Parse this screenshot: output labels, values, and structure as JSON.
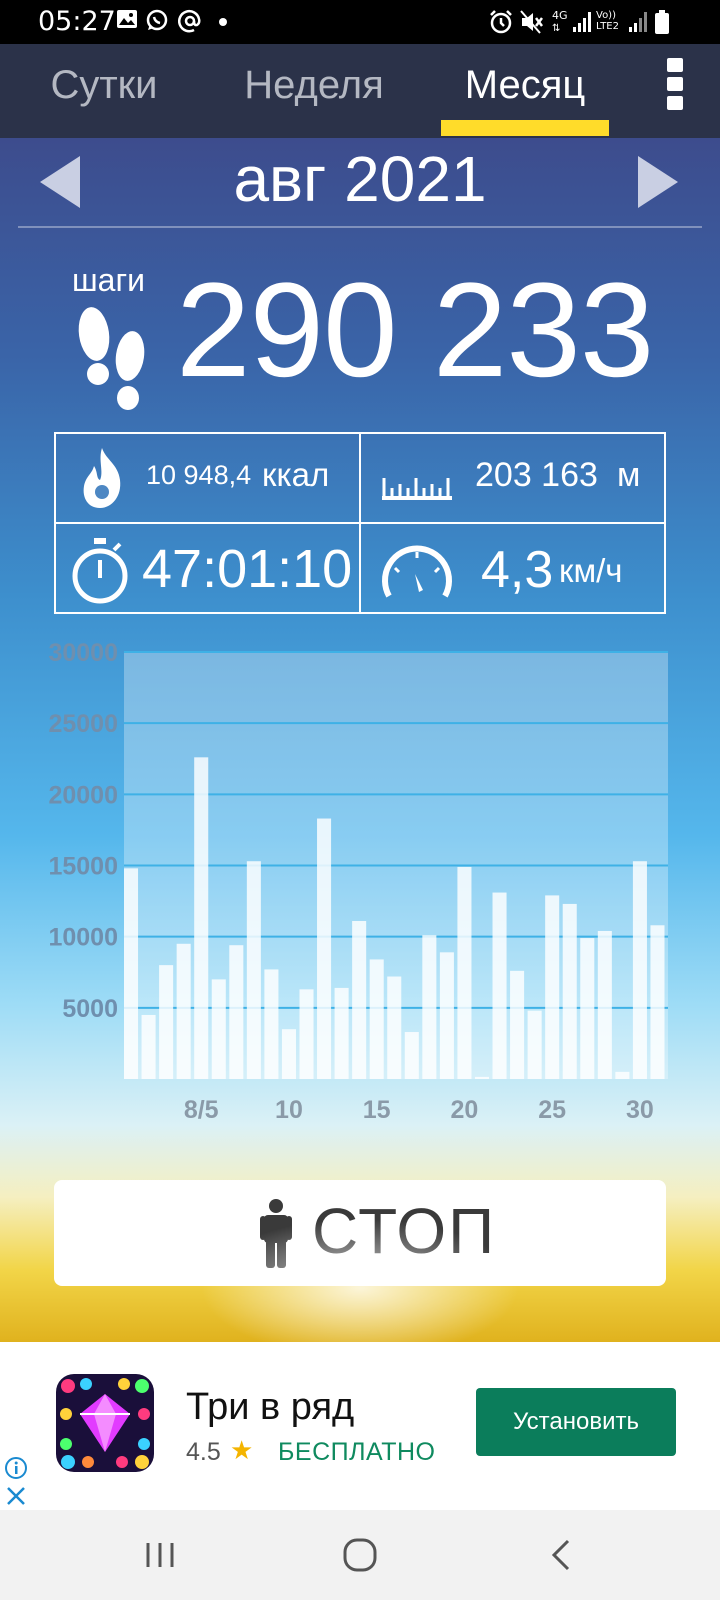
{
  "status_bar": {
    "time": "05:27",
    "left_icons": [
      "image-icon",
      "whatsapp-icon",
      "at-icon",
      "dot-icon"
    ],
    "right_icons": [
      "alarm-icon",
      "mute-icon",
      "4g-icon",
      "signal-icon",
      "volte-icon",
      "signal-icon",
      "battery-icon"
    ],
    "network": "4G",
    "volte": "Vo)) LTE2"
  },
  "tabs": [
    {
      "label": "Сутки",
      "active": false
    },
    {
      "label": "Неделя",
      "active": false
    },
    {
      "label": "Месяц",
      "active": true
    }
  ],
  "period": {
    "title": "авг 2021"
  },
  "steps": {
    "label": "шаги",
    "value": "290 233"
  },
  "stats": {
    "calories": {
      "value": "10 948,4",
      "unit": "ккал"
    },
    "distance": {
      "value": "203 163",
      "unit": "м"
    },
    "time": {
      "value": "47:01:10"
    },
    "speed": {
      "value": "4,3",
      "unit": "км/ч"
    }
  },
  "chart_data": {
    "type": "bar",
    "x": [
      1,
      2,
      3,
      4,
      5,
      6,
      7,
      8,
      9,
      10,
      11,
      12,
      13,
      14,
      15,
      16,
      17,
      18,
      19,
      20,
      21,
      22,
      23,
      24,
      25,
      26,
      27,
      28,
      29,
      30,
      31
    ],
    "values": [
      14800,
      4500,
      8000,
      9500,
      22600,
      7000,
      9400,
      15300,
      7700,
      3500,
      6300,
      18300,
      6400,
      11100,
      8400,
      7200,
      3300,
      10100,
      8900,
      14900,
      150,
      13100,
      7600,
      4800,
      12900,
      12300,
      9900,
      10400,
      500,
      15300,
      10800
    ],
    "ylim": [
      0,
      30000
    ],
    "yticks": [
      "30000",
      "25000",
      "20000",
      "15000",
      "10000",
      "5000"
    ],
    "ytick_values": [
      30000,
      25000,
      20000,
      15000,
      10000,
      5000
    ],
    "xtick_labels": [
      "8/5",
      "10",
      "15",
      "20",
      "25",
      "30"
    ],
    "xtick_days": [
      5,
      10,
      15,
      20,
      25,
      30
    ],
    "grid": true,
    "bar_color": "#ffffff"
  },
  "stop_button": {
    "label": "СТОП"
  },
  "ad": {
    "title": "Три в ряд",
    "rating": "4.5",
    "price": "БЕСПЛАТНО",
    "install_label": "Установить"
  },
  "colors": {
    "tab_bar": "#2b3249",
    "accent": "#ffdc2a",
    "install_button": "#0b7d5b"
  }
}
